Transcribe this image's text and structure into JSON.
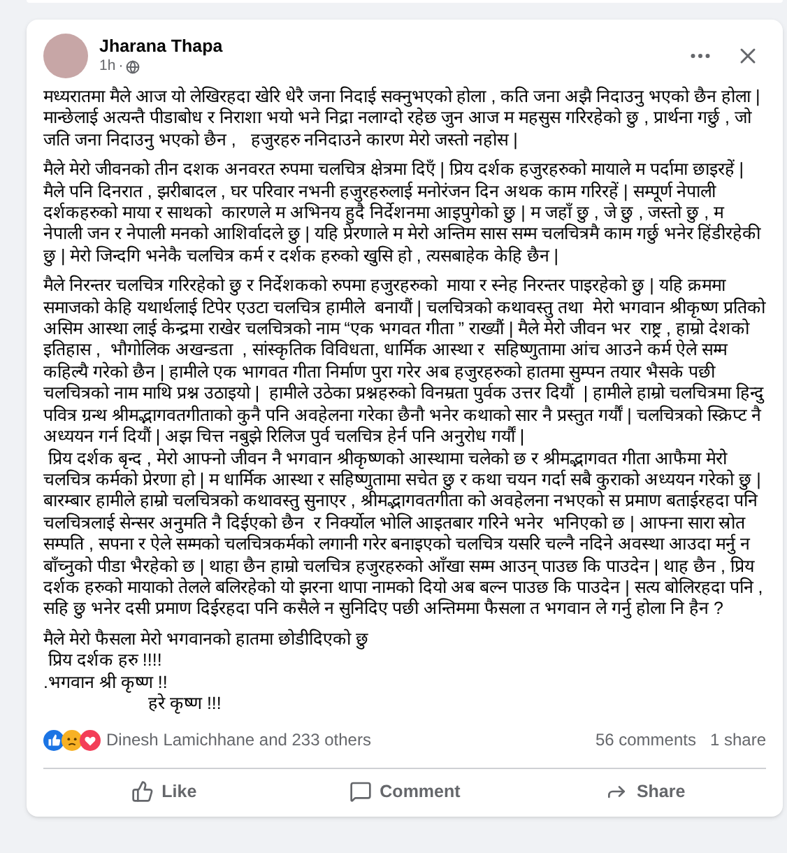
{
  "post": {
    "author": "Jharana Thapa",
    "time": "1h",
    "separator": "·",
    "blocks": [
      {
        "lines": [
          {
            "text": "मध्यरातमा मैले आज यो लेखिरहदा खेरि धेरै जना निदाई सक्नुभएको होला , कति जना अझै निदाउनु भएको छैन होला | मान्छेलाई अत्यन्तै पीडाबोध र निराशा भयो भने निद्रा नलाग्दो रहेछ जुन आज म महसुस गरिरहेको छु , प्रार्थना गर्छु , जो जति जना निदाउनु भएको छैन ,   हजुरहरु ननिदाउने कारण मेरो जस्तो नहोस |",
            "indented": false
          }
        ]
      },
      {
        "lines": [
          {
            "text": "मैले मेरो जीवनको तीन दशक अनवरत रुपमा चलचित्र क्षेत्रमा दिएँ | प्रिय दर्शक हजुरहरुको मायाले म पर्दामा छाइरहें | मैले पनि दिनरात , झरीबादल , घर परिवार नभनी हजुरहरुलाई मनोरंजन दिन अथक काम गरिरहें | सम्पूर्ण नेपाली दर्शकहरुको माया र साथको  कारणले म अभिनय हुदै निर्देशनमा आइपुगेको छु | म जहाँ छु , जे छु , जस्तो छु , म नेपाली जन र नेपाली मनको आशिर्वादले छु | यहि प्रेरणाले म मेरो अन्तिम सास सम्म चलचित्रमै काम गर्छु भनेर हिंडीरहेकी छु | मेरो जिन्दगि भनेकै चलचित्र कर्म र दर्शक हरुको खुसि हो , त्यसबाहेक केहि छैन |",
            "indented": false
          }
        ]
      },
      {
        "lines": [
          {
            "text": "मैले निरन्तर चलचित्र गरिरहेको छु र निर्देशकको रुपमा हजुरहरुको  माया र स्नेह निरन्तर पाइरहेको छु | यहि क्रममा समाजको केहि यथार्थलाई टिपेर एउटा चलचित्र हामीले  बनायौं | चलचित्रको कथावस्तु तथा  मेरो भगवान श्रीकृष्ण प्रतिको असिम आस्था लाई केन्द्रमा राखेर चलचित्रको नाम “एक भगवत गीता ” राख्यौं | मैले मेरो जीवन भर  राष्ट्र , हाम्रो देशको  इतिहास ,  भौगोलिक अखन्डता  , सांस्कृतिक विविधता, धार्मिक आस्था र  सहिष्णुतामा आंच आउने कर्म ऐले सम्म कहिल्यै गरेको छैन | हामीले एक भागवत गीता निर्माण पुरा गरेर अब हजुरहरुको हातमा सुम्पन तयार भैसके पछी चलचित्रको नाम माथि प्रश्न उठाइयो |  हामीले उठेका प्रश्नहरुको विनम्रता पुर्वक उत्तर दियौं  | हामीले हाम्रो चलचित्रमा हिन्दु पवित्र ग्रन्थ श्रीमद्भागवतगीताको कुनै पनि अवहेलना गरेका छैनौ भनेर कथाको सार नै प्रस्तुत गर्यौं | चलचित्रको स्क्रिप्ट नै अध्ययन गर्न दियौं | अझ चित्त नबुझे रिलिज पुर्व चलचित्र हेर्न पनि अनुरोध गर्यौं |",
            "indented": false
          },
          {
            "text": " प्रिय दर्शक बृन्द , मेरो आफ्नो जीवन नै भगवान श्रीकृष्णको आस्थामा चलेको छ र श्रीमद्भागवत गीता आफैमा मेरो चलचित्र कर्मको प्रेरणा हो | म धार्मिक आस्था र सहिष्णुतामा सचेत छु र कथा चयन गर्दा सबै कुराको अध्ययन गरेको छु | बारम्बार हामीले हाम्रो चलचित्रको कथावस्तु सुनाएर , श्रीमद्भागवतगीता को अवहेलना नभएको स प्रमाण बताईरहदा पनि चलचित्रलाई सेन्सर अनुमति नै दिईएको छैन  र निर्क्योल भोलि आइतबार गरिने भनेर  भनिएको छ | आफ्ना सारा स्रोत सम्पति , सपना र ऐले सम्मको चलचित्रकर्मको लगानी गरेर बनाइएको चलचित्र यसरि चल्नै नदिने अवस्था आउदा मर्नु न बाँच्नुको पीडा भैरहेको छ | थाहा छैन हाम्रो चलचित्र हजुरहरुको आँखा सम्म आउन् पाउछ कि पाउदेन | थाह छैन , प्रिय दर्शक हरुको मायाको तेलले बलिरहेको यो झरना थापा नामको दियो अब बल्न पाउछ कि पाउदेन | सत्य बोलिरहदा पनि , सहि छु भनेर दसी प्रमाण दिईरहदा पनि कसैले न सुनिदिए पछी अन्तिममा फैसला त भगवान ले गर्नु होला नि हैन ?",
            "indented": false
          }
        ]
      },
      {
        "lines": [
          {
            "text": "मैले मेरो फैसला मेरो भगवानको हातमा छोडीदिएको छु",
            "indented": false
          },
          {
            "text": " प्रिय दर्शक हरु !!!!",
            "indented": false
          },
          {
            "text": ".भगवान श्री कृष्ण !!",
            "indented": false
          },
          {
            "text": "हरे कृष्ण !!!",
            "indented": true
          }
        ]
      }
    ],
    "reactions": {
      "summary": "Dinesh Lamichhane and 233 others",
      "comments": "56 comments",
      "shares": "1 share"
    },
    "actions": [
      {
        "kind": "like",
        "label": "Like"
      },
      {
        "kind": "comment",
        "label": "Comment"
      },
      {
        "kind": "share",
        "label": "Share"
      }
    ]
  }
}
